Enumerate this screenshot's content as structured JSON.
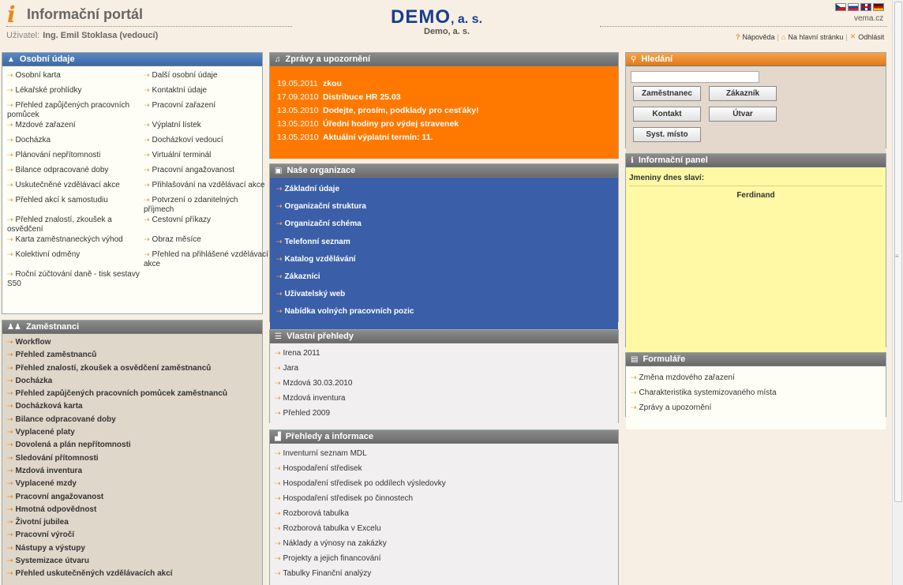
{
  "header": {
    "logo_letter": "i",
    "title": "Informační portál",
    "user_label": "Uživatel:",
    "user_name": "Ing. Emil Stoklasa (vedoucí)",
    "brand_main": "DEMO",
    "brand_sub": ", a. s.",
    "brand_caption": "Demo, a. s.",
    "site": "vema.cz",
    "help": "Nápověda",
    "home": "Na hlavní stránku",
    "logout": "Odhlásit",
    "flags": [
      "cz",
      "sk",
      "en",
      "de"
    ]
  },
  "osobni": {
    "title": "Osobní údaje",
    "items": [
      "Osobní karta",
      "Další osobní údaje",
      "Lékařské prohlídky",
      "Kontaktní údaje",
      "Přehled zapůjčených pracovních pomůcek",
      "Pracovní zařazení",
      "Mzdové zařazení",
      "Výplatní lístek",
      "Docházka",
      "Docházkoví vedoucí",
      "Plánování nepřítomnosti",
      "Virtuální terminál",
      "Bilance odpracované doby",
      "Pracovní angažovanost",
      "Uskutečněné vzdělávací akce",
      "Přihlašování na vzdělávací akce",
      "Přehled akcí k samostudiu",
      "Potvrzení o zdanitelných příjmech",
      "Přehled znalostí, zkoušek a osvědčení",
      "Cestovní příkazy",
      "Karta zaměstnaneckých výhod",
      "Obraz měsíce",
      "Kolektivní odměny",
      "Přehled na přihlášené vzdělávací akce",
      "Roční zúčtování daně - tisk sestavy S50",
      ""
    ]
  },
  "zamestnanci": {
    "title": "Zaměstnanci",
    "items": [
      "Workflow",
      "Přehled zaměstnanců",
      "Přehled znalostí, zkoušek a osvědčení zaměstnanců",
      "Docházka",
      "Přehled zapůjčených pracovních pomůcek zaměstnanců",
      "Docházková karta",
      "Bilance odpracované doby",
      "Vyplacené platy",
      "Dovolená a plán nepřítomnosti",
      "Sledování přítomnosti",
      "Mzdová inventura",
      "Vyplacené mzdy",
      "Pracovní angažovanost",
      "Hmotná odpovědnost",
      "Životní jubilea",
      "Pracovní výročí",
      "Nástupy a výstupy",
      "Systemizace útvaru",
      "Přehled uskutečněných vzdělávacích akcí"
    ]
  },
  "zpravy": {
    "title": "Zprávy a upozornění",
    "items": [
      {
        "date": "19.05.2011",
        "text": "zkou"
      },
      {
        "date": "17.09.2010",
        "text": "Distribuce HR 25.03"
      },
      {
        "date": "13.05.2010",
        "text": "Dodejte, prosím, podklady pro cesťáky!"
      },
      {
        "date": "13.05.2010",
        "text": "Úřední hodiny pro výdej stravenek"
      },
      {
        "date": "13.05.2010",
        "text": "Aktuální výplatní termín: 11."
      }
    ]
  },
  "organizace": {
    "title": "Naše organizace",
    "items": [
      "Základní údaje",
      "Organizační struktura",
      "Organizační schéma",
      "Telefonní seznam",
      "Katalog vzdělávání",
      "Zákazníci",
      "Uživatelský web",
      "Nabídka volných pracovních pozic"
    ]
  },
  "vlastni": {
    "title": "Vlastní přehledy",
    "items": [
      "Irena 2011",
      "Jara",
      "Mzdová 30.03.2010",
      "Mzdová inventura",
      "Přehled 2009"
    ]
  },
  "prehledy": {
    "title": "Přehledy a informace",
    "items": [
      "Inventurní seznam MDL",
      "Hospodaření středisek",
      "Hospodaření středisek po oddílech výsledovky",
      "Hospodaření středisek po činnostech",
      "Rozborová tabulka",
      "Rozborová tabulka v Excelu",
      "Náklady a výnosy na zakázky",
      "Projekty a jejich financování",
      "Tabulky Finanční analýzy"
    ]
  },
  "hledani": {
    "title": "Hledání",
    "search_value": "",
    "buttons": [
      "Zaměstnanec",
      "Zákazník",
      "Kontakt",
      "Útvar",
      "Syst. místo"
    ]
  },
  "info": {
    "title": "Informační panel",
    "label": "Jmeniny dnes slaví:",
    "name": "Ferdinand"
  },
  "formulare": {
    "title": "Formuláře",
    "items": [
      "Změna mzdového zařazení",
      "Charakteristika systemizovaného místa",
      "Zprávy a upozornění"
    ]
  }
}
